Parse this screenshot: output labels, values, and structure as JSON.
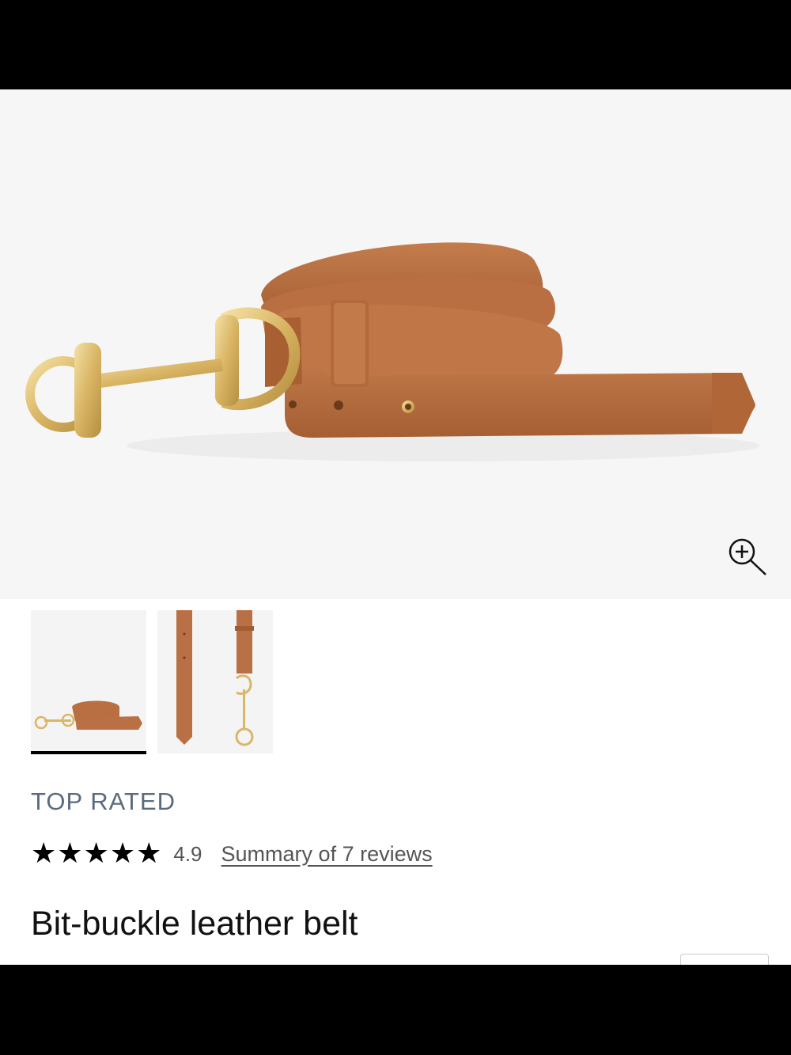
{
  "product": {
    "badge": "TOP RATED",
    "stars": "★★★★★",
    "rating": "4.9",
    "reviews_link": "Summary of 7 reviews",
    "title": "Bit-buckle leather belt"
  },
  "gallery": {
    "images": [
      "belt-coiled-view",
      "belt-flat-view"
    ],
    "selected_index": 0
  },
  "icons": {
    "zoom": "zoom-in-icon"
  },
  "colors": {
    "leather": "#b87044",
    "hardware_gold": "#d9b766",
    "badge_text": "#5b6b7e"
  }
}
